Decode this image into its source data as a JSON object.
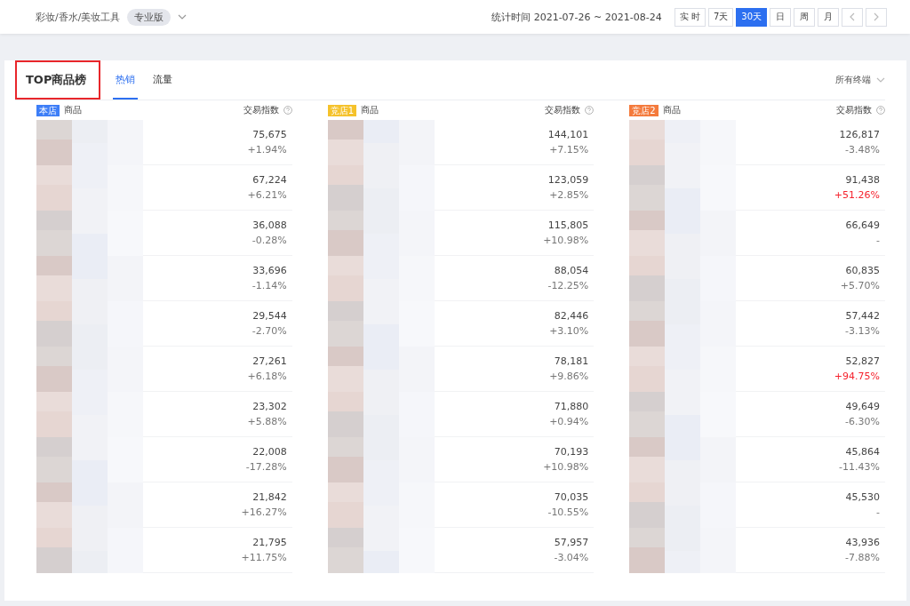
{
  "top_bar": {
    "breadcrumb": "彩妆/香水/美妆工具",
    "edition_badge": "专业版",
    "period_label": "统计时间 2021-07-26 ~ 2021-08-24",
    "range_buttons": [
      {
        "label": "实 时",
        "selected": false
      },
      {
        "label": "7天",
        "selected": false
      },
      {
        "label": "30天",
        "selected": true
      },
      {
        "label": "日",
        "selected": false
      },
      {
        "label": "周",
        "selected": false
      },
      {
        "label": "月",
        "selected": false
      }
    ]
  },
  "panel": {
    "title": "TOP商品榜",
    "tabs": [
      {
        "label": "热销",
        "selected": true
      },
      {
        "label": "流量",
        "selected": false
      }
    ],
    "terminal_filter": "所有终端",
    "columns": [
      {
        "store": "本店",
        "color": "#3d7ef7",
        "product_header": "商品",
        "index_header": "交易指数",
        "rows": [
          {
            "value": "75,675",
            "change": "+1.94%",
            "highlight": false
          },
          {
            "value": "67,224",
            "change": "+6.21%",
            "highlight": false
          },
          {
            "value": "36,088",
            "change": "-0.28%",
            "highlight": false
          },
          {
            "value": "33,696",
            "change": "-1.14%",
            "highlight": false
          },
          {
            "value": "29,544",
            "change": "-2.70%",
            "highlight": false
          },
          {
            "value": "27,261",
            "change": "+6.18%",
            "highlight": false
          },
          {
            "value": "23,302",
            "change": "+5.88%",
            "highlight": false
          },
          {
            "value": "22,008",
            "change": "-17.28%",
            "highlight": false
          },
          {
            "value": "21,842",
            "change": "+16.27%",
            "highlight": false
          },
          {
            "value": "21,795",
            "change": "+11.75%",
            "highlight": false
          }
        ]
      },
      {
        "store": "竞店1",
        "color": "#f5c22b",
        "product_header": "商品",
        "index_header": "交易指数",
        "rows": [
          {
            "value": "144,101",
            "change": "+7.15%",
            "highlight": false
          },
          {
            "value": "123,059",
            "change": "+2.85%",
            "highlight": false
          },
          {
            "value": "115,805",
            "change": "+10.98%",
            "highlight": false
          },
          {
            "value": "88,054",
            "change": "-12.25%",
            "highlight": false
          },
          {
            "value": "82,446",
            "change": "+3.10%",
            "highlight": false
          },
          {
            "value": "78,181",
            "change": "+9.86%",
            "highlight": false
          },
          {
            "value": "71,880",
            "change": "+0.94%",
            "highlight": false
          },
          {
            "value": "70,193",
            "change": "+10.98%",
            "highlight": false
          },
          {
            "value": "70,035",
            "change": "-10.55%",
            "highlight": false
          },
          {
            "value": "57,957",
            "change": "-3.04%",
            "highlight": false
          }
        ]
      },
      {
        "store": "竞店2",
        "color": "#f47a3c",
        "product_header": "商品",
        "index_header": "交易指数",
        "rows": [
          {
            "value": "126,817",
            "change": "-3.48%",
            "highlight": false
          },
          {
            "value": "91,438",
            "change": "+51.26%",
            "highlight": true
          },
          {
            "value": "66,649",
            "change": "-",
            "highlight": false
          },
          {
            "value": "60,835",
            "change": "+5.70%",
            "highlight": false
          },
          {
            "value": "57,442",
            "change": "-3.13%",
            "highlight": false
          },
          {
            "value": "52,827",
            "change": "+94.75%",
            "highlight": true
          },
          {
            "value": "49,649",
            "change": "-6.30%",
            "highlight": false
          },
          {
            "value": "45,864",
            "change": "-11.43%",
            "highlight": false
          },
          {
            "value": "45,530",
            "change": "-",
            "highlight": false
          },
          {
            "value": "43,936",
            "change": "-7.88%",
            "highlight": false
          }
        ]
      }
    ]
  }
}
